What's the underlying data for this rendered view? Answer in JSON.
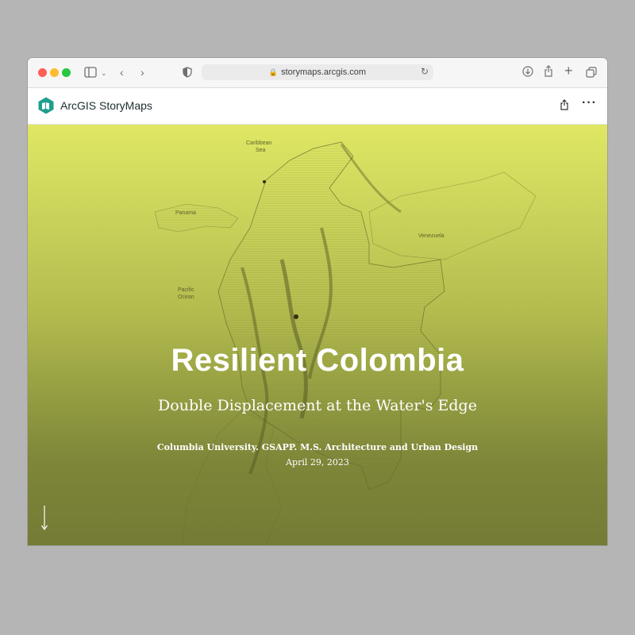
{
  "browser": {
    "url": "storymaps.arcgis.com"
  },
  "app": {
    "brand": "ArcGIS StoryMaps"
  },
  "map_labels": {
    "caribbean_line1": "Caribbean",
    "caribbean_line2": "Sea",
    "panama": "Panama",
    "venezuela": "Venezuela",
    "pacific_line1": "Pacific",
    "pacific_line2": "Ocean"
  },
  "hero": {
    "title": "Resilient Colombia",
    "subtitle": "Double Displacement at the Water's Edge",
    "byline": "Columbia University. GSAPP. M.S. Architecture and Urban Design",
    "date": "April 29, 2023"
  },
  "colors": {
    "hero_top": "#dfe764",
    "hero_bottom": "#747b35",
    "brand_teal": "#1f9e8f"
  }
}
